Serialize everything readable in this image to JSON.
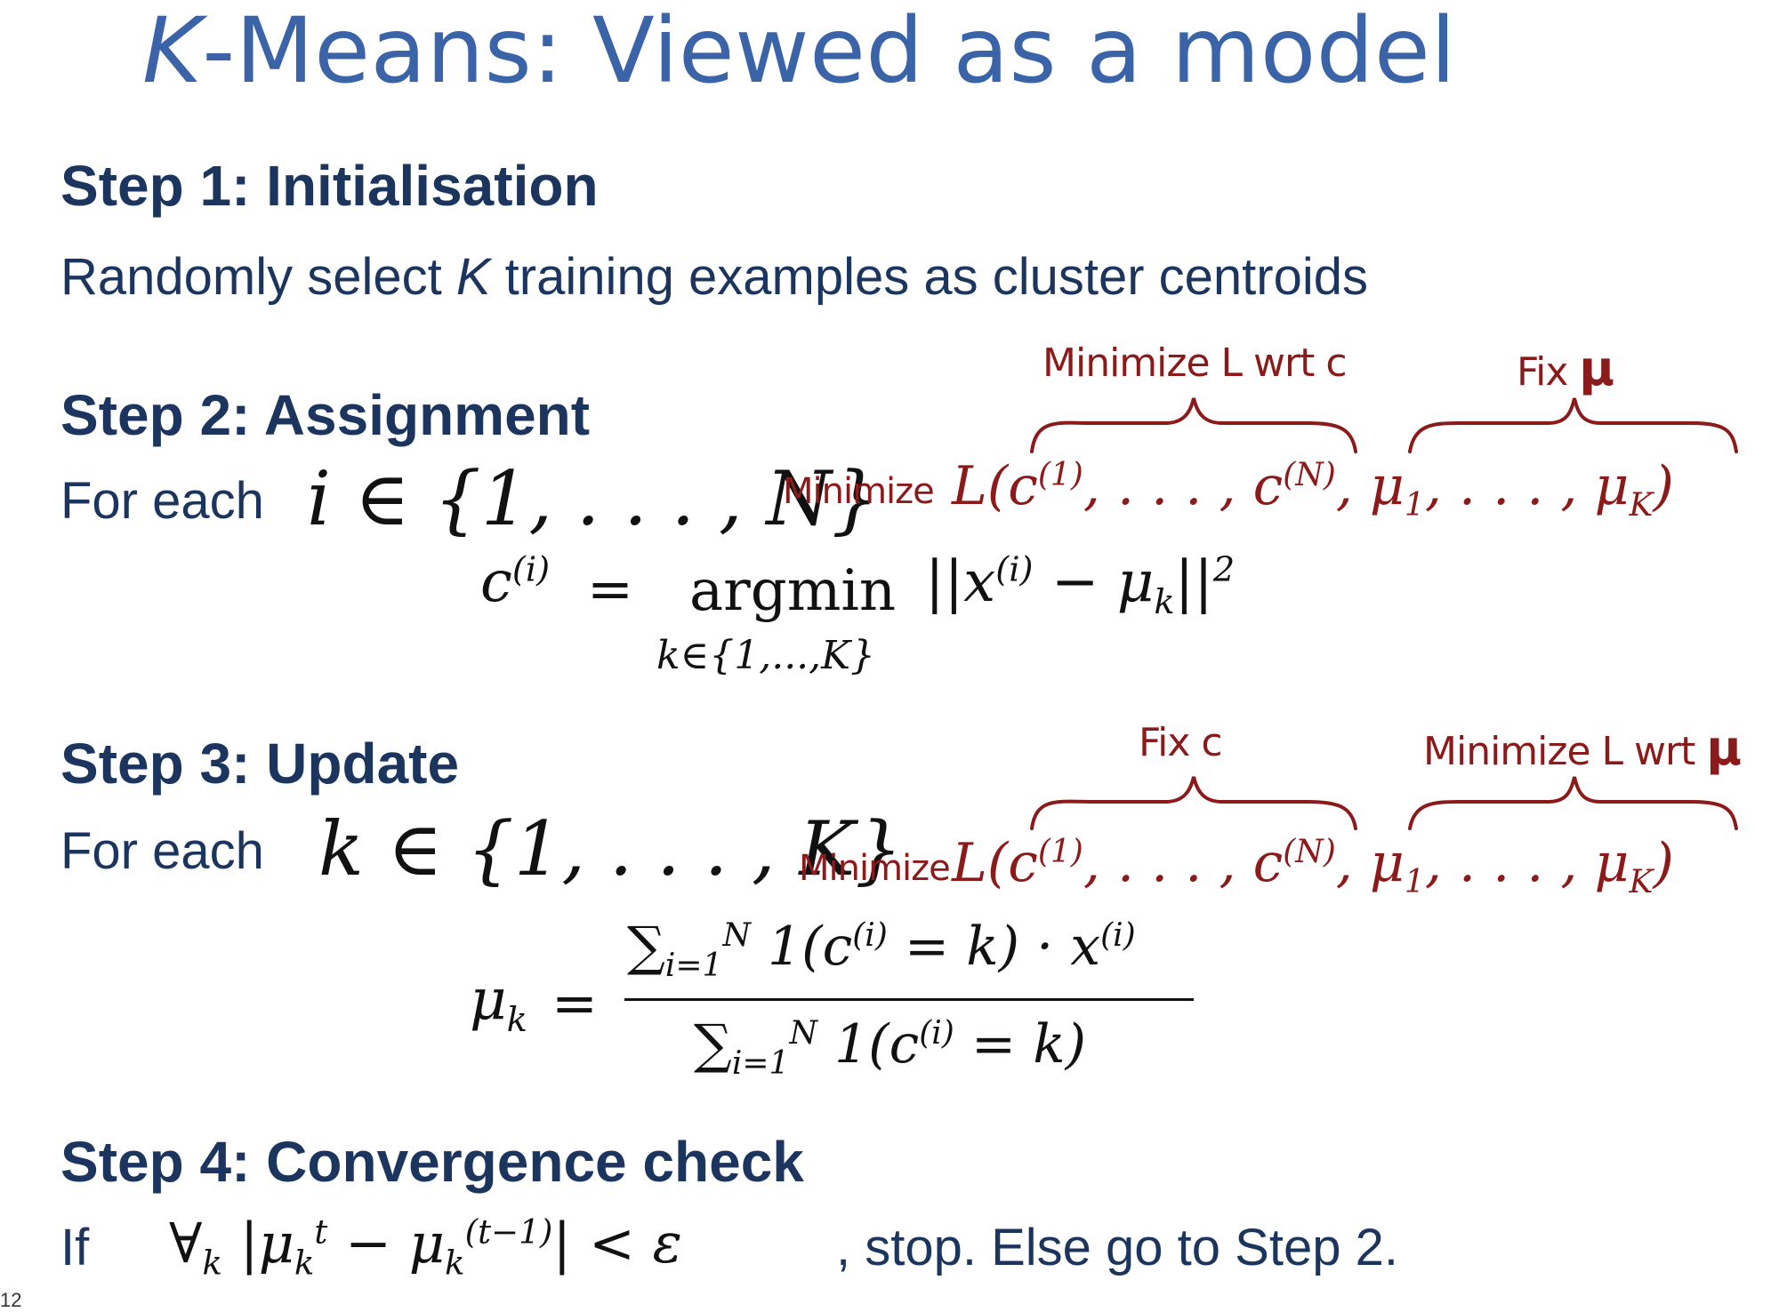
{
  "title": {
    "k": "K",
    "rest": "-Means: Viewed as a model"
  },
  "step1": {
    "heading": "Step 1: Initialisation",
    "text_a": "Randomly select ",
    "text_k": "K",
    "text_b": " training examples as cluster centroids"
  },
  "step2": {
    "heading": "Step 2: Assignment",
    "for_each": "For each",
    "index_set": "i ∈ {1, . . . , N}",
    "minimize": "Minimize",
    "objective": "L(c(1), . . . , c(N), μ1, . . . , μK)",
    "note_left": "Minimize L wrt c",
    "note_right_a": "Fix ",
    "note_right_mu": "μ",
    "formula_lhs": "c(i)",
    "formula_eq": "=",
    "formula_op": "argmin",
    "formula_sub": "k∈{1,...,K}",
    "formula_rhs": "||x(i) − μk||2"
  },
  "step3": {
    "heading": "Step 3: Update",
    "for_each": "For each",
    "index_set": "k ∈ {1, . . . , K}",
    "minimize": "Minimize",
    "objective": "L(c(1), . . . , c(N), μ1, . . . , μK)",
    "note_left": "Fix c",
    "note_right_a": "Minimize L wrt ",
    "note_right_mu": "μ",
    "formula_lhs": "μk",
    "formula_eq": "=",
    "numerator": "∑i=1N 1(c(i) = k) · x(i)",
    "denominator": "∑i=1N 1(c(i) = k)"
  },
  "step4": {
    "heading": "Step 4: Convergence check",
    "if": "If",
    "condition": "∀k |μkt − μk(t−1)| < ε",
    "tail": ", stop. Else go to Step 2."
  },
  "page_number": "12",
  "colors": {
    "title": "#3b64a8",
    "text": "#1c355e",
    "annotation": "#8b1a1a"
  }
}
